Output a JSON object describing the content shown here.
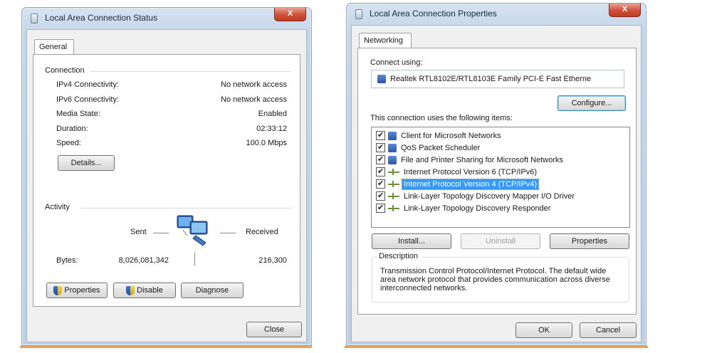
{
  "status_window": {
    "title": "Local Area Connection Status",
    "close_label": "X",
    "tab_general": "General",
    "connection": {
      "group_label": "Connection",
      "rows": [
        {
          "label": "IPv4 Connectivity:",
          "value": "No network access"
        },
        {
          "label": "IPv6 Connectivity:",
          "value": "No network access"
        },
        {
          "label": "Media State:",
          "value": "Enabled"
        },
        {
          "label": "Duration:",
          "value": "02:33:12"
        },
        {
          "label": "Speed:",
          "value": "100.0 Mbps"
        }
      ],
      "details_button": "Details..."
    },
    "activity": {
      "group_label": "Activity",
      "sent_label": "Sent",
      "received_label": "Received",
      "bytes_label": "Bytes:",
      "bytes_sent": "8,026,081,342",
      "bytes_received": "216,300"
    },
    "buttons": {
      "properties": "Properties",
      "disable": "Disable",
      "diagnose": "Diagnose",
      "close": "Close"
    }
  },
  "properties_window": {
    "title": "Local Area Connection Properties",
    "close_label": "X",
    "tab_networking": "Networking",
    "connect_using_label": "Connect using:",
    "adapter_name": "Realtek RTL8102E/RTL8103E Family PCI-E Fast Etherne",
    "configure_button": "Configure...",
    "items_label": "This connection uses the following items:",
    "items": [
      {
        "label": "Client for Microsoft Networks",
        "checked": true,
        "icon": "network-client-icon"
      },
      {
        "label": "QoS Packet Scheduler",
        "checked": true,
        "icon": "network-service-icon"
      },
      {
        "label": "File and Printer Sharing for Microsoft Networks",
        "checked": true,
        "icon": "network-service-icon"
      },
      {
        "label": "Internet Protocol Version 6 (TCP/IPv6)",
        "checked": true,
        "icon": "protocol-icon"
      },
      {
        "label": "Internet Protocol Version 4 (TCP/IPv4)",
        "checked": true,
        "icon": "protocol-icon",
        "selected": true
      },
      {
        "label": "Link-Layer Topology Discovery Mapper I/O Driver",
        "checked": true,
        "icon": "protocol-icon"
      },
      {
        "label": "Link-Layer Topology Discovery Responder",
        "checked": true,
        "icon": "protocol-icon"
      }
    ],
    "buttons": {
      "install": "Install...",
      "uninstall": "Uninstall",
      "properties": "Properties",
      "ok": "OK",
      "cancel": "Cancel"
    },
    "description": {
      "group_label": "Description",
      "text": "Transmission Control Protocol/Internet Protocol. The default wide area network protocol that provides communication across diverse interconnected networks."
    }
  },
  "colors": {
    "selection": "#3399ff",
    "close_button": "#c13a24",
    "accent_underline": "#e8a35b"
  }
}
